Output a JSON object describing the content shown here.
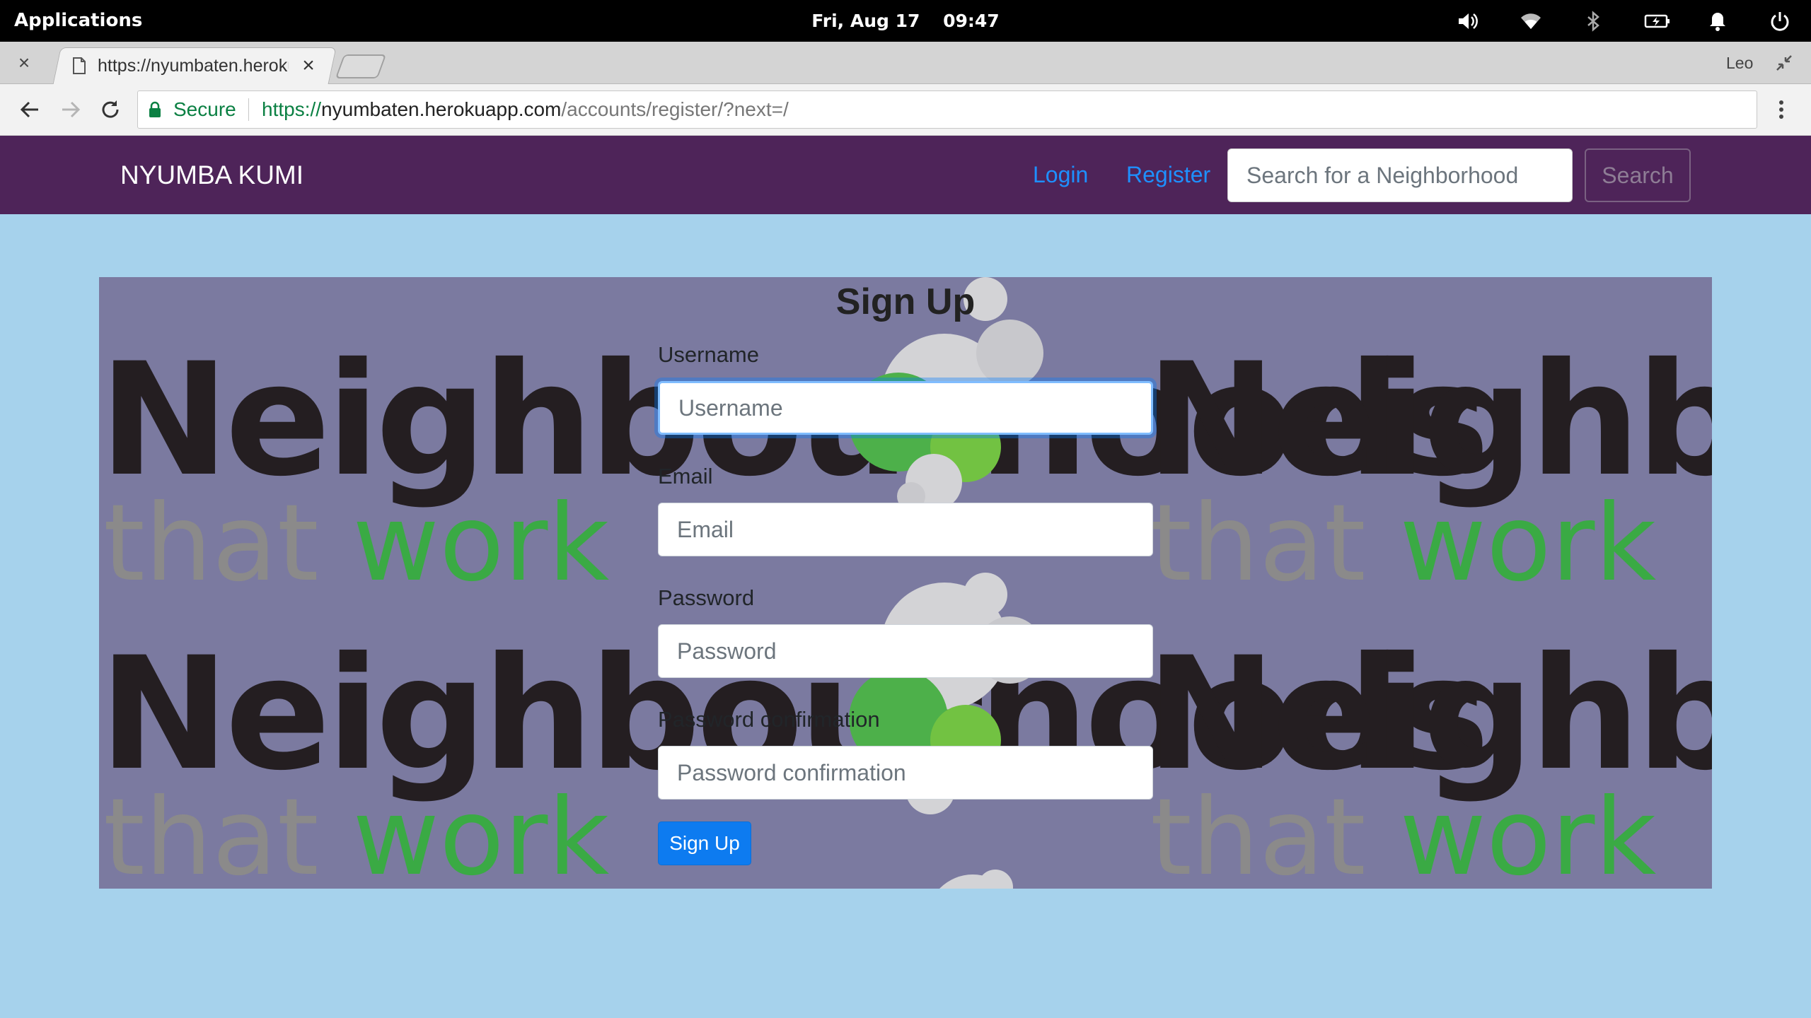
{
  "system_bar": {
    "applications_label": "Applications",
    "date": "Fri, Aug 17",
    "time": "09:47"
  },
  "browser": {
    "tab_title": "https://nyumbaten.herokuapp.com/accounts/register/?next=/",
    "profile_name": "Leo",
    "secure_label": "Secure",
    "url_scheme": "https://",
    "url_host": "nyumbaten.herokuapp.com",
    "url_path": "/accounts/register/?next=/"
  },
  "navbar": {
    "brand": "NYUMBA KUMI",
    "login_label": "Login",
    "register_label": "Register",
    "search_placeholder": "Search for a Neighborhood",
    "search_button": "Search",
    "background_color": "#4e2459",
    "link_color": "#1e90ff"
  },
  "hero": {
    "logo_word": "Neighbourhoods",
    "logo_tagline_that": "that",
    "logo_tagline_work": "work"
  },
  "signup_form": {
    "title": "Sign Up",
    "fields": [
      {
        "label": "Username",
        "placeholder": "Username",
        "focused": true
      },
      {
        "label": "Email",
        "placeholder": "Email"
      },
      {
        "label": "Password",
        "placeholder": "Password"
      },
      {
        "label": "Password confirmation",
        "placeholder": "Password confirmation"
      }
    ],
    "submit_label": "Sign Up",
    "submit_color": "#0d7bf0"
  },
  "colors": {
    "page_background": "#a6d2ec",
    "panel_background": "#7b7aa0"
  }
}
